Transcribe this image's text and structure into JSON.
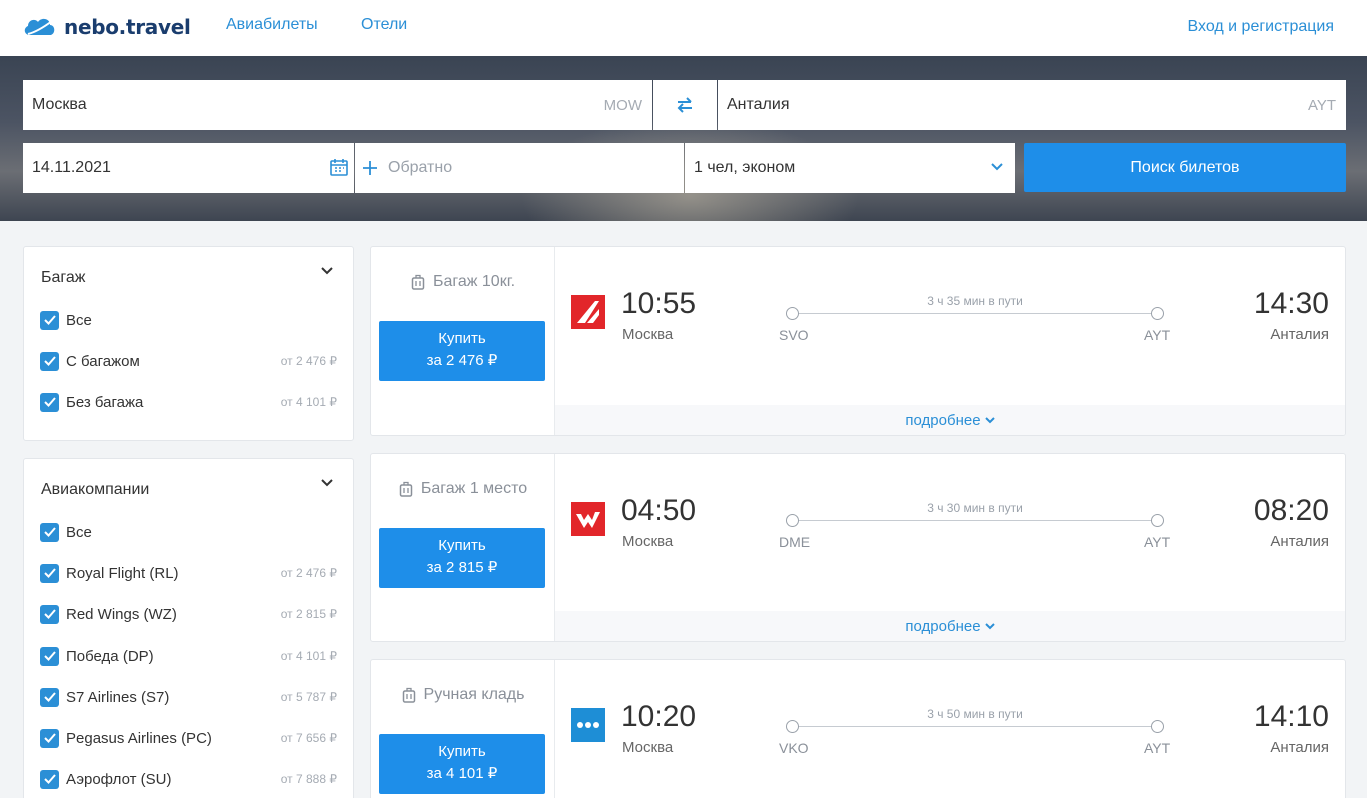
{
  "header": {
    "logo_text": "nebo.travel",
    "nav": [
      "Авиабилеты",
      "Отели"
    ],
    "login": "Вход и регистрация"
  },
  "search": {
    "from_city": "Москва",
    "from_code": "MOW",
    "to_city": "Анталия",
    "to_code": "AYT",
    "date": "14.11.2021",
    "return_placeholder": "Обратно",
    "passengers": "1 чел, эконом",
    "search_button": "Поиск билетов"
  },
  "filters": {
    "baggage": {
      "title": "Багаж",
      "items": [
        {
          "label": "Все",
          "price": ""
        },
        {
          "label": "С багажом",
          "price": "от 2 476 ₽"
        },
        {
          "label": "Без багажа",
          "price": "от 4 101 ₽"
        }
      ]
    },
    "airlines": {
      "title": "Авиакомпании",
      "items": [
        {
          "label": "Все",
          "price": ""
        },
        {
          "label": "Royal Flight (RL)",
          "price": "от 2 476 ₽"
        },
        {
          "label": "Red Wings (WZ)",
          "price": "от 2 815 ₽"
        },
        {
          "label": "Победа (DP)",
          "price": "от 4 101 ₽"
        },
        {
          "label": "S7 Airlines (S7)",
          "price": "от 5 787 ₽"
        },
        {
          "label": "Pegasus Airlines (PC)",
          "price": "от 7 656 ₽"
        },
        {
          "label": "Аэрофлот (SU)",
          "price": "от 7 888 ₽"
        }
      ]
    }
  },
  "results": [
    {
      "baggage": "Багаж 10кг.",
      "buy_label": "Купить",
      "price": "за 2 476 ₽",
      "airline": "Royal Flight",
      "dep_time": "10:55",
      "dep_city": "Москва",
      "dep_code": "SVO",
      "arr_time": "14:30",
      "arr_city": "Анталия",
      "arr_code": "AYT",
      "duration": "3 ч 35 мин в пути",
      "details": "подробнее"
    },
    {
      "baggage": "Багаж 1 место",
      "buy_label": "Купить",
      "price": "за 2 815 ₽",
      "airline": "Red Wings",
      "dep_time": "04:50",
      "dep_city": "Москва",
      "dep_code": "DME",
      "arr_time": "08:20",
      "arr_city": "Анталия",
      "arr_code": "AYT",
      "duration": "3 ч 30 мин в пути",
      "details": "подробнее"
    },
    {
      "baggage": "Ручная кладь",
      "buy_label": "Купить",
      "price": "за 4 101 ₽",
      "airline": "Победа",
      "dep_time": "10:20",
      "dep_city": "Москва",
      "dep_code": "VKO",
      "arr_time": "14:10",
      "arr_city": "Анталия",
      "arr_code": "AYT",
      "duration": "3 ч 50 мин в пути",
      "details": ""
    }
  ],
  "colors": {
    "accent": "#1e8ee9",
    "link": "#2b8fd6",
    "logo": "#1a3d6e"
  }
}
